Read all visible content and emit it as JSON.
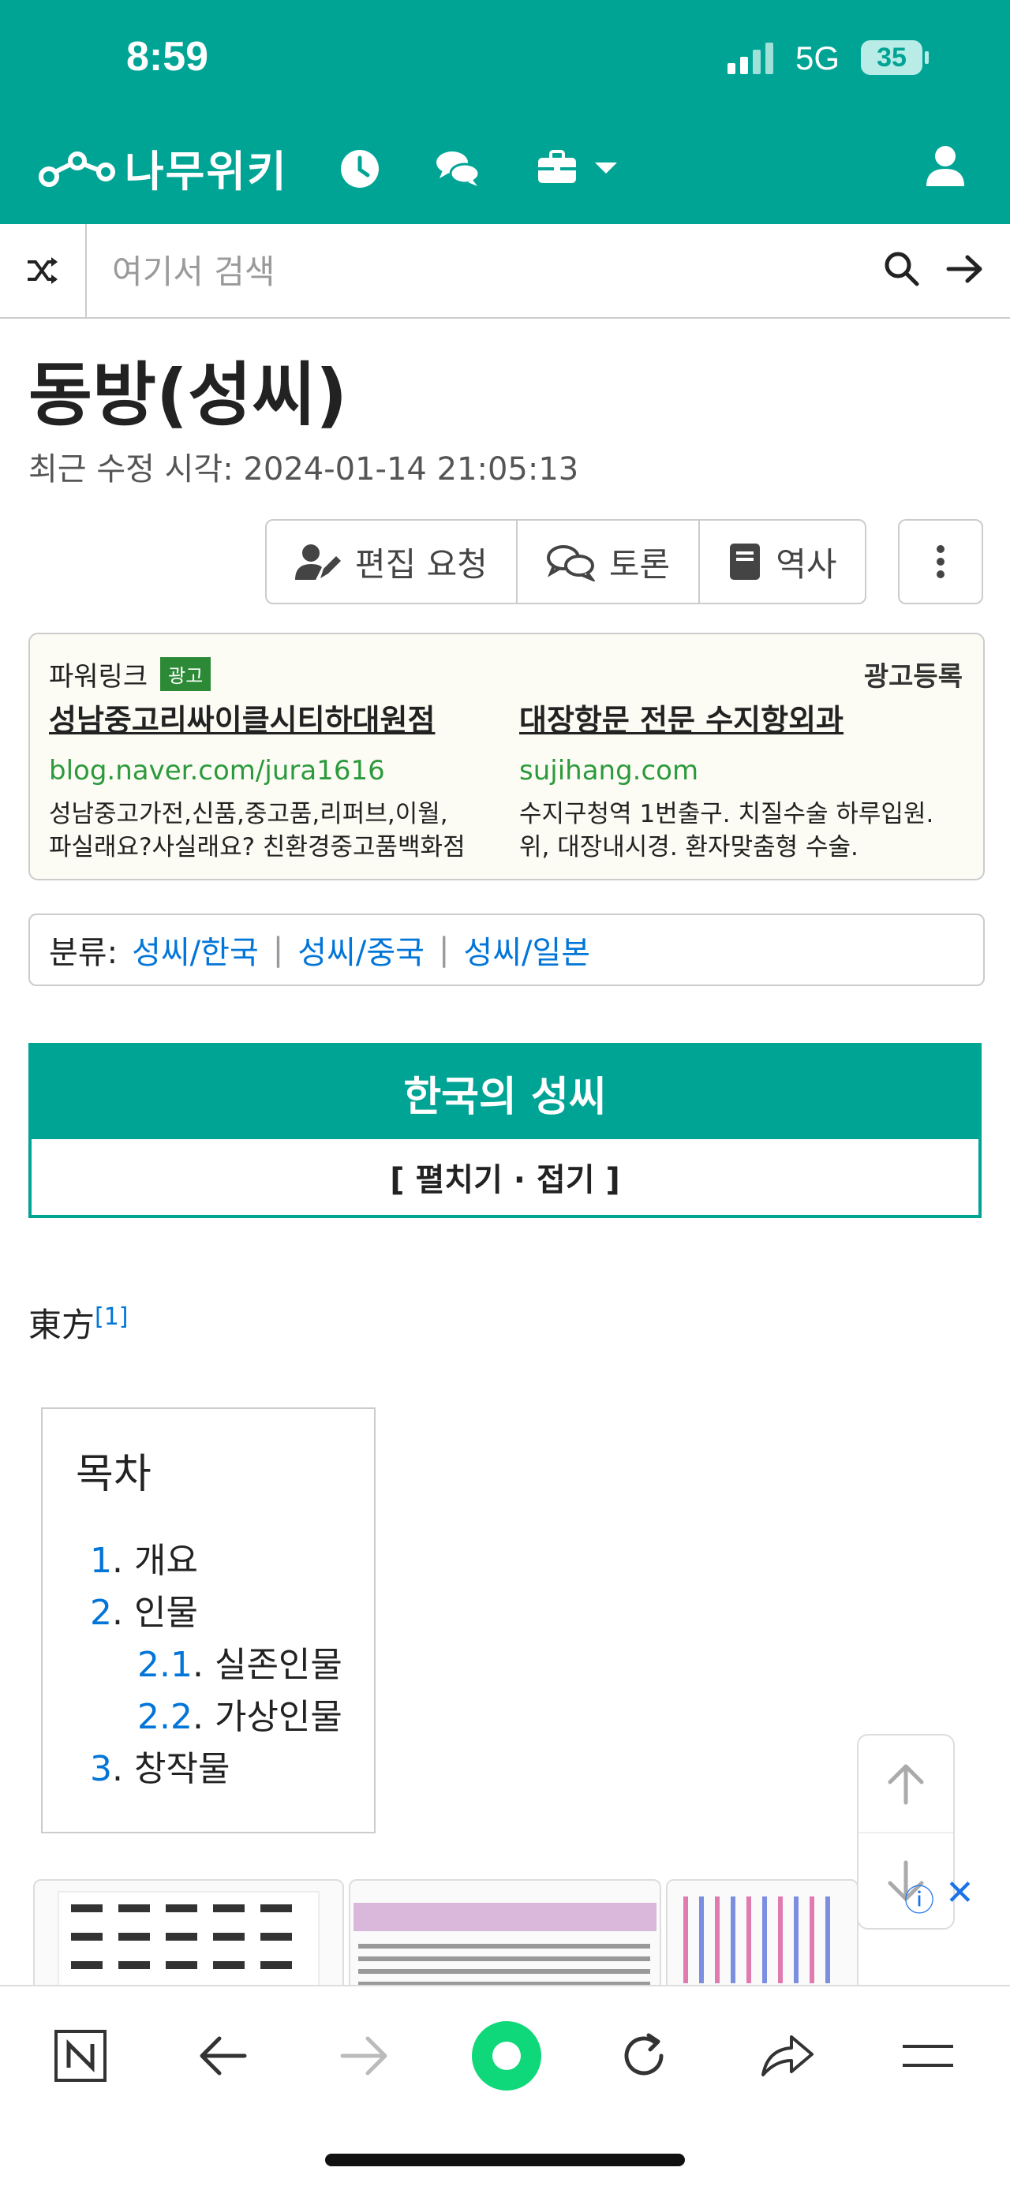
{
  "status": {
    "time": "8:59",
    "network": "5G",
    "battery": "35"
  },
  "header": {
    "logo_text": "나무위키"
  },
  "search": {
    "placeholder": "여기서 검색"
  },
  "article": {
    "title": "동방(성씨)",
    "modified": "최근 수정 시각: 2024-01-14 21:05:13",
    "hanja": "東方",
    "footnote": "[1]"
  },
  "actions": {
    "edit_request": "편집 요청",
    "discussion": "토론",
    "history": "역사"
  },
  "ad": {
    "label": "파워링크",
    "badge": "광고",
    "register": "광고등록",
    "items": [
      {
        "title": "성남중고리싸이클시티하대원점",
        "url": "blog.naver.com/jura1616",
        "desc1": "성남중고가전,신품,중고품,리퍼브,이월,",
        "desc2": "파실래요?사실래요? 친환경중고품백화점"
      },
      {
        "title": "대장항문 전문 수지항외과",
        "url": "sujihang.com",
        "desc1": "수지구청역 1번출구. 치질수술 하루입원.",
        "desc2": "위, 대장내시경. 환자맞춤형 수술."
      }
    ]
  },
  "categories": {
    "label": "분류:",
    "links": [
      "성씨/한국",
      "성씨/중국",
      "성씨/일본"
    ]
  },
  "navbox": {
    "title": "한국의 성씨",
    "toggle": "[ 펼치기 · 접기 ]"
  },
  "toc": {
    "title": "목차",
    "items": [
      {
        "num": "1",
        "label": "개요"
      },
      {
        "num": "2",
        "label": "인물"
      },
      {
        "num": "2.1",
        "label": "실존인물"
      },
      {
        "num": "2.2",
        "label": "가상인물"
      },
      {
        "num": "3",
        "label": "창작물"
      }
    ]
  },
  "colors": {
    "brand": "#00a495",
    "link": "#0275d8",
    "ad_url": "#2c9a3c"
  }
}
